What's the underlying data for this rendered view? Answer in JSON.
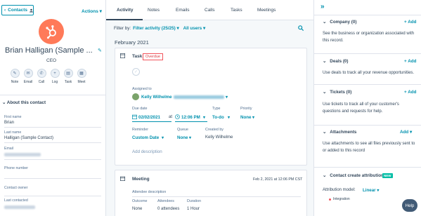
{
  "left": {
    "contacts_button": "Contacts",
    "actions_label": "Actions",
    "name": "Brian Halligan (Sample ...",
    "job_title": "CEO",
    "activity_actions": [
      {
        "label": "Note",
        "icon": "note-icon"
      },
      {
        "label": "Email",
        "icon": "email-icon"
      },
      {
        "label": "Call",
        "icon": "call-icon"
      },
      {
        "label": "Log",
        "icon": "log-icon"
      },
      {
        "label": "Task",
        "icon": "task-icon"
      },
      {
        "label": "Meet",
        "icon": "meet-icon"
      }
    ],
    "about_title": "About this contact",
    "fields": {
      "first_name_label": "First name",
      "first_name_value": "Brian",
      "last_name_label": "Last name",
      "last_name_value": "Halligan (Sample Contact)",
      "email_label": "Email",
      "phone_label": "Phone number",
      "owner_label": "Contact owner",
      "last_contacted_label": "Last contacted"
    }
  },
  "middle": {
    "tabs": [
      "Activity",
      "Notes",
      "Emails",
      "Calls",
      "Tasks",
      "Meetings"
    ],
    "active_tab": "Activity",
    "filter_label": "Filter by:",
    "filter_activity": "Filter activity (25/25)",
    "filter_users": "All users",
    "month": "February 2021",
    "task": {
      "title": "Task",
      "badge": "Overdue",
      "assigned_label": "Assigned to",
      "assignee_name": "Kelly Wilhelme",
      "due_label": "Due date",
      "due_date": "02/02/2021",
      "due_at": "at",
      "due_time": "12:06 PM",
      "type_label": "Type",
      "type_value": "To-do",
      "priority_label": "Priority",
      "priority_value": "None",
      "reminder_label": "Reminder",
      "reminder_value": "Custom Date",
      "queue_label": "Queue",
      "queue_value": "None",
      "created_by_label": "Created by",
      "created_by_value": "Kelly Wilhelme",
      "add_description": "Add description"
    },
    "meeting": {
      "title": "Meeting",
      "timestamp": "Feb 2, 2021 at 12:06 PM CST",
      "attendee_desc_label": "Attendee description",
      "outcome_label": "Outcome",
      "outcome_value": "None",
      "attendees_label": "Attendees",
      "attendees_value": "0 attendees",
      "duration_label": "Duration",
      "duration_value": "1 Hour"
    }
  },
  "right": {
    "sections": [
      {
        "title": "Company (0)",
        "add": "+ Add",
        "desc": "See the business or organization associated with this record."
      },
      {
        "title": "Deals (0)",
        "add": "+ Add",
        "desc": "Use deals to track all your revenue opportunities."
      },
      {
        "title": "Tickets (0)",
        "add": "+ Add",
        "desc": "Use tickets to track all of your customer's questions and requests for help."
      },
      {
        "title": "Attachments",
        "add": "Add",
        "desc": "Use attachments to see all files previously sent to or added to this record"
      }
    ],
    "attribution_title": "Contact create attribution",
    "new_badge": "NEW",
    "attribution_model_label": "Attribution model:",
    "attribution_model_value": "Linear",
    "integration_label": "Integration",
    "help_button": "Help"
  },
  "colors": {
    "accent": "#0091ae",
    "orange": "#ff7a59",
    "overdue": "#f2545b",
    "new_badge": "#00bda5"
  }
}
